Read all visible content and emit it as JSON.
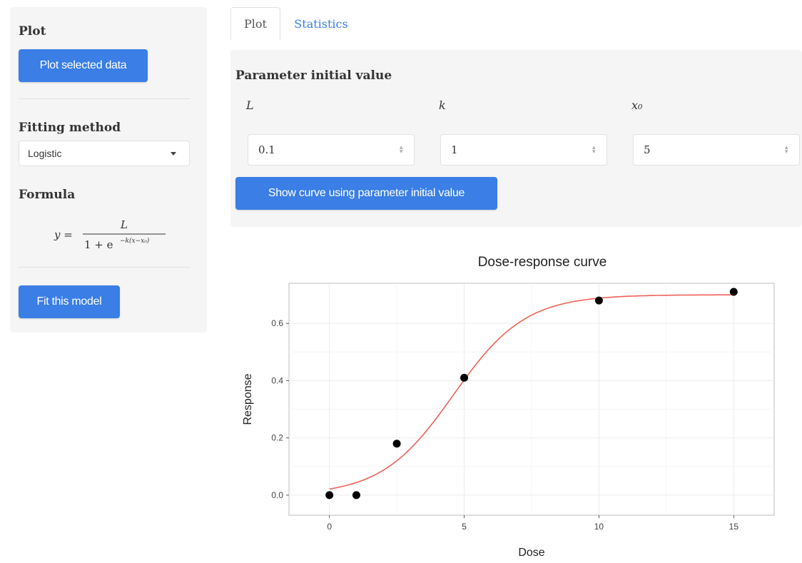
{
  "sidebar": {
    "plot_heading": "Plot",
    "plot_button": "Plot selected data",
    "fitting_heading": "Fitting method",
    "fitting_value": "Logistic",
    "formula_heading": "Formula",
    "formula": {
      "lhs": "y =",
      "numerator": "L",
      "denominator": "1 + e",
      "exponent": "−k(x−x₀)"
    },
    "fit_button": "Fit this model"
  },
  "tabs": [
    {
      "label": "Plot",
      "active": true
    },
    {
      "label": "Statistics",
      "active": false
    }
  ],
  "parameters": {
    "heading": "Parameter initial value",
    "items": [
      {
        "label": "L",
        "value": "0.1"
      },
      {
        "label": "k",
        "value": "1"
      },
      {
        "label": "x₀",
        "value": "5"
      }
    ],
    "show_curve_button": "Show curve using parameter initial value"
  },
  "colors": {
    "accent": "#3a7ee6",
    "curve": "#f0605a",
    "points": "#000000"
  },
  "chart_data": {
    "type": "scatter",
    "title": "Dose-response curve",
    "xlabel": "Dose",
    "ylabel": "Response",
    "xlim": [
      -1.5,
      16.5
    ],
    "ylim": [
      -0.07,
      0.74
    ],
    "x_ticks": [
      0,
      5,
      10,
      15
    ],
    "x_tick_labels": [
      "0",
      "5",
      "10",
      "15"
    ],
    "y_ticks": [
      0.0,
      0.2,
      0.4,
      0.6
    ],
    "y_tick_labels": [
      "0.0",
      "0.2",
      "0.4",
      "0.6"
    ],
    "grid": true,
    "points": {
      "x": [
        0,
        1,
        2.5,
        5,
        10,
        15
      ],
      "y": [
        0.0,
        0.0,
        0.18,
        0.41,
        0.68,
        0.71
      ]
    },
    "fitted_curve": {
      "model": "logistic",
      "L": 0.7,
      "k": 0.75,
      "x0": 4.6,
      "x_range": [
        0,
        15
      ]
    }
  }
}
